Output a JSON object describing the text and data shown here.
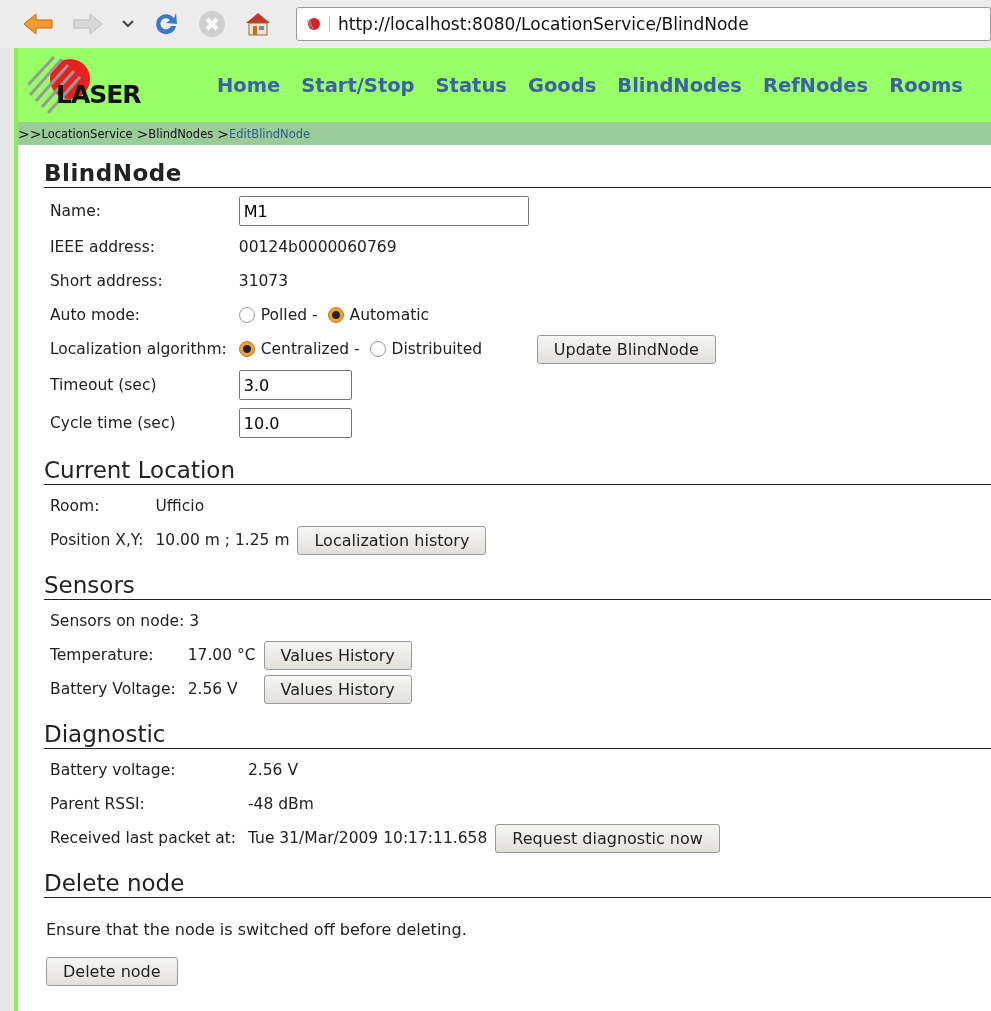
{
  "browser": {
    "url": "http://localhost:8080/LocationService/BlindNode"
  },
  "nav": {
    "logo": "LASER",
    "links": [
      "Home",
      "Start/Stop",
      "Status",
      "Goods",
      "BlindNodes",
      "RefNodes",
      "Rooms"
    ]
  },
  "breadcrumb": [
    {
      "sep": ">>",
      "label": "LocationService",
      "current": false
    },
    {
      "sep": ">",
      "label": "BlindNodes",
      "current": false
    },
    {
      "sep": ">",
      "label": "EditBlindNode",
      "current": true
    }
  ],
  "sections": [
    {
      "title": "BlindNode",
      "bold": true,
      "rows": [
        {
          "kind": "text_input",
          "label": "Name:",
          "value": "M1"
        },
        {
          "kind": "text",
          "label": "IEEE address:",
          "value": "00124b0000060769"
        },
        {
          "kind": "text",
          "label": "Short address:",
          "value": "31073"
        },
        {
          "kind": "radio",
          "label": "Auto mode:",
          "options": [
            {
              "label": "Polled -",
              "selected": false
            },
            {
              "label": "Automatic",
              "selected": true
            }
          ]
        },
        {
          "kind": "radio",
          "label": "Localization algorithm:",
          "options": [
            {
              "label": "Centralized -",
              "selected": true
            },
            {
              "label": "Distribuited",
              "selected": false
            }
          ],
          "button": "Update BlindNode"
        },
        {
          "kind": "number_input",
          "label": "Timeout (sec)",
          "value": "3.0"
        },
        {
          "kind": "number_input",
          "label": "Cycle time (sec)",
          "value": "10.0"
        }
      ]
    },
    {
      "title": "Current Location",
      "bold": false,
      "rows": [
        {
          "kind": "text",
          "label": "Room:",
          "value": "Ufficio"
        },
        {
          "kind": "text",
          "label": "Position X,Y:",
          "value": "10.00 m ; 1.25 m",
          "button": "Localization history"
        }
      ]
    },
    {
      "title": "Sensors",
      "bold": false,
      "rows": [
        {
          "kind": "span",
          "label": "Sensors on node: 3"
        },
        {
          "kind": "text",
          "label": "Temperature:",
          "value": "17.00 °C",
          "button": "Values History"
        },
        {
          "kind": "text",
          "label": "Battery Voltage:",
          "value": "2.56 V",
          "button": "Values History"
        }
      ]
    },
    {
      "title": "Diagnostic",
      "bold": false,
      "rows": [
        {
          "kind": "text",
          "label": "Battery voltage:",
          "value": "2.56 V"
        },
        {
          "kind": "text",
          "label": "Parent RSSI:",
          "value": "-48 dBm"
        },
        {
          "kind": "text",
          "label": "Received last packet at:",
          "value": "Tue 31/Mar/2009 10:17:11.658",
          "button": "Request diagnostic now"
        }
      ]
    },
    {
      "title": "Delete node",
      "bold": false,
      "note": "Ensure that the node is switched off before deleting.",
      "button": "Delete node"
    }
  ]
}
